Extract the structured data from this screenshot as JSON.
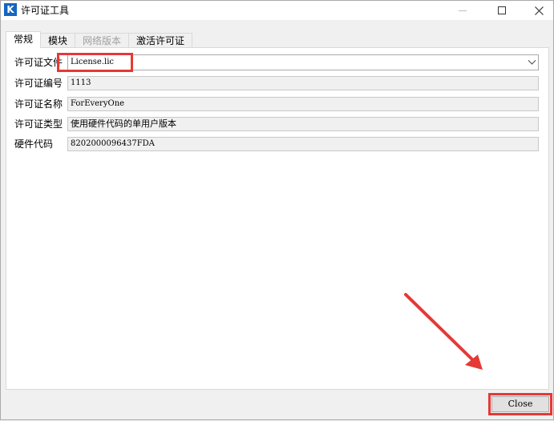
{
  "window": {
    "title": "许可证工具",
    "app_icon_letter": "K",
    "accent_color": "#1565c0",
    "controls": [
      "minimize-icon",
      "maximize-icon",
      "close-icon"
    ]
  },
  "tabs": [
    {
      "label": "常规",
      "state": "active"
    },
    {
      "label": "模块",
      "state": "normal"
    },
    {
      "label": "网络版本",
      "state": "disabled"
    },
    {
      "label": "激活许可证",
      "state": "normal"
    }
  ],
  "fields": {
    "license_file": {
      "label": "许可证文件",
      "value": "License.lic"
    },
    "license_number": {
      "label": "许可证编号",
      "value": "1113"
    },
    "license_name": {
      "label": "许可证名称",
      "value": "ForEveryOne"
    },
    "license_type": {
      "label": "许可证类型",
      "value": "使用硬件代码的单用户版本"
    },
    "hardware_code": {
      "label": "硬件代码",
      "value": "8202000096437FDA"
    }
  },
  "footer": {
    "close_label": "Close"
  },
  "annotations": {
    "highlight_color": "#e53935"
  }
}
